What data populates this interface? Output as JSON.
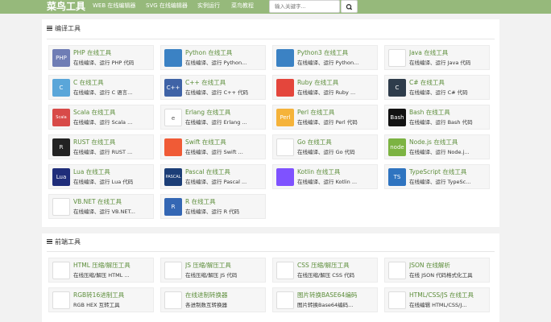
{
  "navbar": {
    "logo": "菜鸟工具",
    "links": [
      "WEB 在线编辑器",
      "SVG 在线编辑器",
      "实例运行",
      "菜鸟教程"
    ],
    "search_placeholder": "输入关键字..."
  },
  "sections": [
    {
      "title": "编译工具",
      "tools": [
        {
          "title": "PHP 在线工具",
          "desc": "在线编译、运行 PHP 代码",
          "icon": "php-icon",
          "icon_text": "PHP",
          "color": "#6f7db5"
        },
        {
          "title": "Python 在线工具",
          "desc": "在线编译、运行 Python...",
          "icon": "python-icon",
          "icon_text": "",
          "color": "#3b82c4"
        },
        {
          "title": "Python3 在线工具",
          "desc": "在线编译、运行 Python...",
          "icon": "python3-icon",
          "icon_text": "",
          "color": "#3b82c4"
        },
        {
          "title": "Java 在线工具",
          "desc": "在线编译、运行 Java 代码",
          "icon": "java-icon",
          "icon_text": "",
          "color": "#ffffff"
        },
        {
          "title": "C 在线工具",
          "desc": "在线编译、运行 C 语言...",
          "icon": "c-icon",
          "icon_text": "C",
          "color": "#5aa6d9"
        },
        {
          "title": "C++ 在线工具",
          "desc": "在线编译、运行 C++ 代码",
          "icon": "cpp-icon",
          "icon_text": "C++",
          "color": "#3f63a6"
        },
        {
          "title": "Ruby 在线工具",
          "desc": "在线编译、运行 Ruby ...",
          "icon": "ruby-icon",
          "icon_text": "",
          "color": "#e4463c"
        },
        {
          "title": "C# 在线工具",
          "desc": "在线编译、运行 C# 代码",
          "icon": "csharp-icon",
          "icon_text": "C",
          "color": "#2e3c4b"
        },
        {
          "title": "Scala 在线工具",
          "desc": "在线编译、运行 Scala ...",
          "icon": "scala-icon",
          "icon_text": "Scala",
          "color": "#d84a48"
        },
        {
          "title": "Erlang 在线工具",
          "desc": "在线编译、运行 Erlang ...",
          "icon": "erlang-icon",
          "icon_text": "e",
          "color": "#ffffff"
        },
        {
          "title": "Perl 在线工具",
          "desc": "在线编译、运行 Perl 代码",
          "icon": "perl-icon",
          "icon_text": "Perl",
          "color": "#f5b33a"
        },
        {
          "title": "Bash 在线工具",
          "desc": "在线编译、运行 Bash 代码",
          "icon": "bash-icon",
          "icon_text": "Bash",
          "color": "#111111"
        },
        {
          "title": "RUST 在线工具",
          "desc": "在线编译、运行 RUST ...",
          "icon": "rust-icon",
          "icon_text": "R",
          "color": "#222222"
        },
        {
          "title": "Swift 在线工具",
          "desc": "在线编译、运行 Swift ...",
          "icon": "swift-icon",
          "icon_text": "",
          "color": "#f05b36"
        },
        {
          "title": "Go 在线工具",
          "desc": "在线编译、运行 Go 代码",
          "icon": "go-icon",
          "icon_text": "",
          "color": "#ffffff"
        },
        {
          "title": "Node.js 在线工具",
          "desc": "在线编译、运行 Node.j...",
          "icon": "nodejs-icon",
          "icon_text": "node",
          "color": "#7cb342"
        },
        {
          "title": "Lua 在线工具",
          "desc": "在线编译、运行 Lua 代码",
          "icon": "lua-icon",
          "icon_text": "Lua",
          "color": "#1f2d7a"
        },
        {
          "title": "Pascal 在线工具",
          "desc": "在线编译、运行 Pascal ...",
          "icon": "pascal-icon",
          "icon_text": "PASCAL",
          "color": "#1c3e77"
        },
        {
          "title": "Kotlin 在线工具",
          "desc": "在线编译、运行 Kotlin ...",
          "icon": "kotlin-icon",
          "icon_text": "",
          "color": "#7f52ff"
        },
        {
          "title": "TypeScript 在线工具",
          "desc": "在线编译、运行 TypeSc...",
          "icon": "typescript-icon",
          "icon_text": "TS",
          "color": "#2f74c0"
        },
        {
          "title": "VB.NET 在线工具",
          "desc": "在线编译、运行 VB.NET...",
          "icon": "vbnet-icon",
          "icon_text": "",
          "color": "#ffffff"
        },
        {
          "title": "R 在线工具",
          "desc": "在线编译、运行 R 代码",
          "icon": "r-icon",
          "icon_text": "R",
          "color": "#3467b4"
        }
      ]
    },
    {
      "title": "前端工具",
      "tools": [
        {
          "title": "HTML 压缩/解压工具",
          "desc": "在线压缩/解压 HTML ...",
          "icon": "html-compress-icon",
          "icon_text": "",
          "color": "#ffffff"
        },
        {
          "title": "JS 压缩/解压工具",
          "desc": "在线压缩/解压 JS 代码",
          "icon": "js-compress-icon",
          "icon_text": "",
          "color": "#ffffff"
        },
        {
          "title": "CSS 压缩/解压工具",
          "desc": "在线压缩/解压 CSS 代码",
          "icon": "css-compress-icon",
          "icon_text": "",
          "color": "#ffffff"
        },
        {
          "title": "JSON 在线解析",
          "desc": "在线 JSON 代码格式化工具",
          "icon": "json-icon",
          "icon_text": "",
          "color": "#ffffff"
        },
        {
          "title": "RGB转16进制工具",
          "desc": "RGB HEX 互转工具",
          "icon": "rgb-icon",
          "icon_text": "",
          "color": "#ffffff"
        },
        {
          "title": "在线进制转换器",
          "desc": "各进制数互转换器",
          "icon": "radix-icon",
          "icon_text": "",
          "color": "#ffffff"
        },
        {
          "title": "图片转换BASE64编码",
          "desc": "图片转换Base64编码...",
          "icon": "base64-icon",
          "icon_text": "",
          "color": "#ffffff"
        },
        {
          "title": "HTML/CSS/JS 在线工具",
          "desc": "在线编辑 HTML/CSS/J...",
          "icon": "html-editor-icon",
          "icon_text": "",
          "color": "#ffffff"
        }
      ]
    }
  ]
}
